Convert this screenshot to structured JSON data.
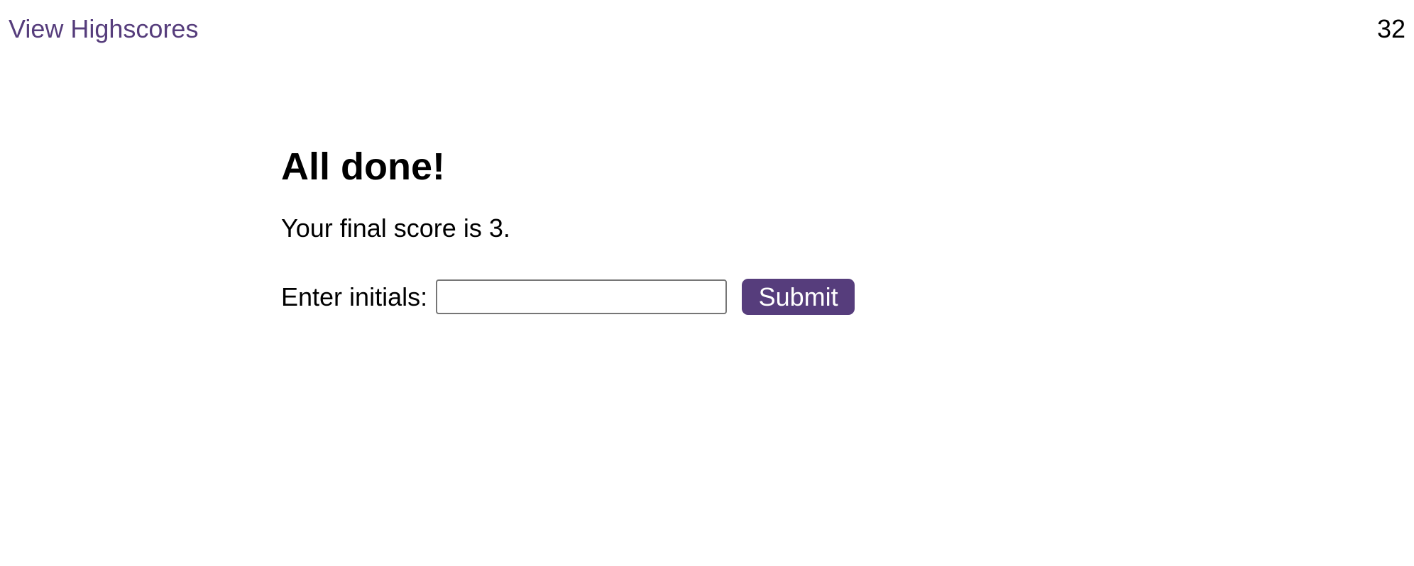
{
  "header": {
    "highscores_link": "View Highscores",
    "timer": "32"
  },
  "main": {
    "title": "All done!",
    "score_text": "Your final score is 3.",
    "initials_label": "Enter initials:",
    "initials_value": "",
    "submit_label": "Submit"
  },
  "colors": {
    "accent": "#563d7c"
  }
}
